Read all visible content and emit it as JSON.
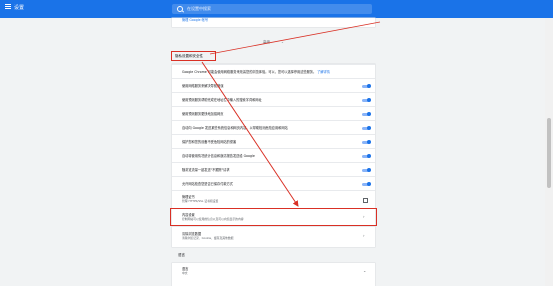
{
  "window": {
    "title": "设置"
  },
  "search": {
    "placeholder": "在设置中搜索"
  },
  "top_card": {
    "link": "管理 Google 帐号"
  },
  "advanced": {
    "label": "高级"
  },
  "privacy": {
    "title": "隐私设置和安全性",
    "rows": [
      {
        "title": "Google Chrome 可能会使用网络服务来改善您的浏览体验。可以，您可以选择停用这些服务。",
        "link": "了解详情"
      },
      {
        "title": "使用网络服务来解决导航错误"
      },
      {
        "title": "使用预测服务帮助完成在地址栏中输入的搜索字词和网址"
      },
      {
        "title": "使用预测服务更快地加载网页"
      },
      {
        "title": "自动向 Google 发送某些系统信息和网页内容，以帮助检测危险应用和网站"
      },
      {
        "title": "保护您和您的设备不受危险网站的侵害"
      },
      {
        "title": "自动将使用情况统计信息和崩溃报告发送给 Google"
      },
      {
        "title": "随浏览流量一起发送\"不跟踪\"请求"
      },
      {
        "title": "允许网站检查您是否已保存付款方式"
      },
      {
        "title": "管理证书",
        "subtitle": "管理 HTTPS/SSL 证书和设置"
      },
      {
        "title": "内容设置",
        "subtitle": "控制网站可以使用的信息以及可以向您显示的内容"
      },
      {
        "title": "清除浏览数据",
        "subtitle": "清除浏览记录、Cookie、缓存及其他数据"
      }
    ]
  },
  "languages": {
    "title": "语言",
    "rows": [
      {
        "title": "语言",
        "subtitle": "中文"
      }
    ]
  },
  "colors": {
    "accent": "#1a73e8",
    "highlight": "#d93025"
  }
}
